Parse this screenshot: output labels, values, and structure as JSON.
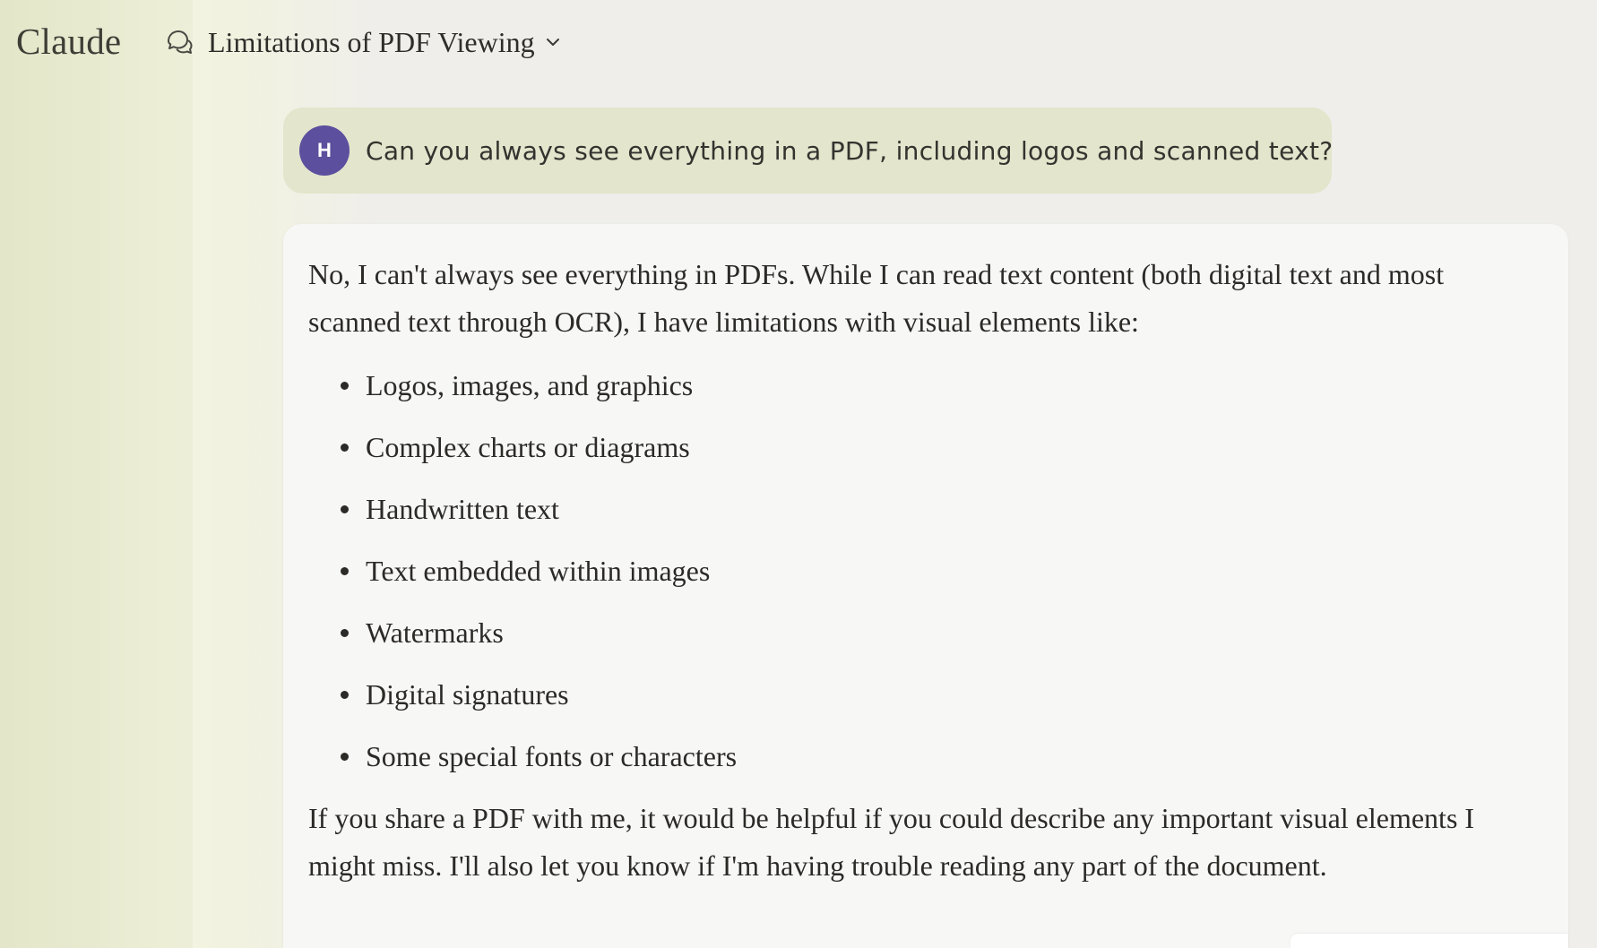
{
  "app": {
    "brand": "Claude"
  },
  "header": {
    "chat_title": "Limitations of PDF Viewing",
    "chat_icon": "chat-bubbles-icon",
    "dropdown_icon": "chevron-down-icon"
  },
  "user_message": {
    "avatar_initial": "H",
    "avatar_color": "#5c4f9e",
    "text": "Can you always see everything in a PDF, including logos and scanned text?"
  },
  "assistant_message": {
    "intro": "No, I can't always see everything in PDFs. While I can read text content (both digital text and most scanned text through OCR), I have limitations with visual elements like:",
    "items": [
      "Logos, images, and graphics",
      "Complex charts or diagrams",
      "Handwritten text",
      "Text embedded within images",
      "Watermarks",
      "Digital signatures",
      "Some special fonts or characters"
    ],
    "outro": "If you share a PDF with me, it would be helpful if you could describe any important visual elements I might miss. I'll also let you know if I'm having trouble reading any part of the document."
  },
  "colors": {
    "user_bubble": "#e3e5cc",
    "assistant_card": "#f7f7f5",
    "page_background": "#efeeea"
  }
}
